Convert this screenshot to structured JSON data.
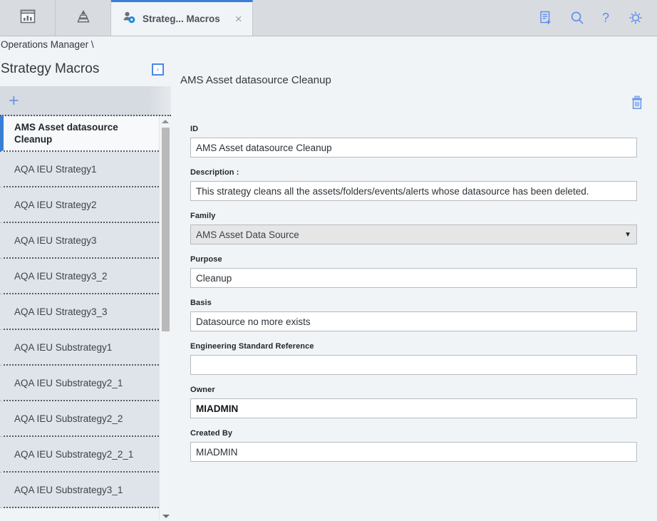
{
  "appbar": {
    "buttons": [
      {
        "name": "dashboard-icon",
        "title": "Dashboard"
      },
      {
        "name": "pyramid-icon",
        "title": "Hierarchy"
      }
    ],
    "tab": {
      "label": "Strateg... Macros",
      "close_label": "×",
      "icon": "strategy-macros-icon"
    },
    "right_icons": [
      {
        "name": "new-document-icon"
      },
      {
        "name": "search-icon"
      },
      {
        "name": "help-icon"
      },
      {
        "name": "gear-icon"
      }
    ],
    "accent_color": "#3a7fd5",
    "icon_color": "#5b8def",
    "background": "#d8dce1"
  },
  "breadcrumb": {
    "text": "Operations Manager \\"
  },
  "sidebar": {
    "title": "Strategy Macros",
    "collapse_label": "‹",
    "add_label": "+",
    "items": [
      {
        "label": "AMS Asset datasource\nCleanup",
        "selected": true
      },
      {
        "label": "AQA IEU Strategy1",
        "selected": false
      },
      {
        "label": "AQA IEU Strategy2",
        "selected": false
      },
      {
        "label": "AQA IEU Strategy3",
        "selected": false
      },
      {
        "label": "AQA IEU Strategy3_2",
        "selected": false
      },
      {
        "label": "AQA IEU Strategy3_3",
        "selected": false
      },
      {
        "label": "AQA IEU Substrategy1",
        "selected": false
      },
      {
        "label": "AQA IEU Substrategy2_1",
        "selected": false
      },
      {
        "label": "AQA IEU Substrategy2_2",
        "selected": false
      },
      {
        "label": "AQA IEU Substrategy2_2_1",
        "selected": false
      },
      {
        "label": "AQA IEU Substrategy3_1",
        "selected": false
      }
    ]
  },
  "main": {
    "page_title": "AMS Asset datasource Cleanup",
    "delete_icon": "trash-icon",
    "fields": [
      {
        "label": "ID",
        "value": "AMS Asset datasource Cleanup",
        "type": "text",
        "bold": false
      },
      {
        "label": "Description :",
        "value": "This strategy cleans all the assets/folders/events/alerts whose datasource has been deleted.",
        "type": "text",
        "bold": false
      },
      {
        "label": "Family",
        "value": "AMS Asset Data Source",
        "type": "select",
        "bold": false,
        "caret": "▼"
      },
      {
        "label": "Purpose",
        "value": "Cleanup",
        "type": "text",
        "bold": false
      },
      {
        "label": "Basis",
        "value": "Datasource no more exists",
        "type": "text",
        "bold": false
      },
      {
        "label": "Engineering Standard Reference",
        "value": "",
        "type": "text",
        "bold": false
      },
      {
        "label": "Owner",
        "value": "MIADMIN",
        "type": "text",
        "bold": true
      },
      {
        "label": "Created By",
        "value": "MIADMIN",
        "type": "text",
        "bold": false
      }
    ]
  }
}
